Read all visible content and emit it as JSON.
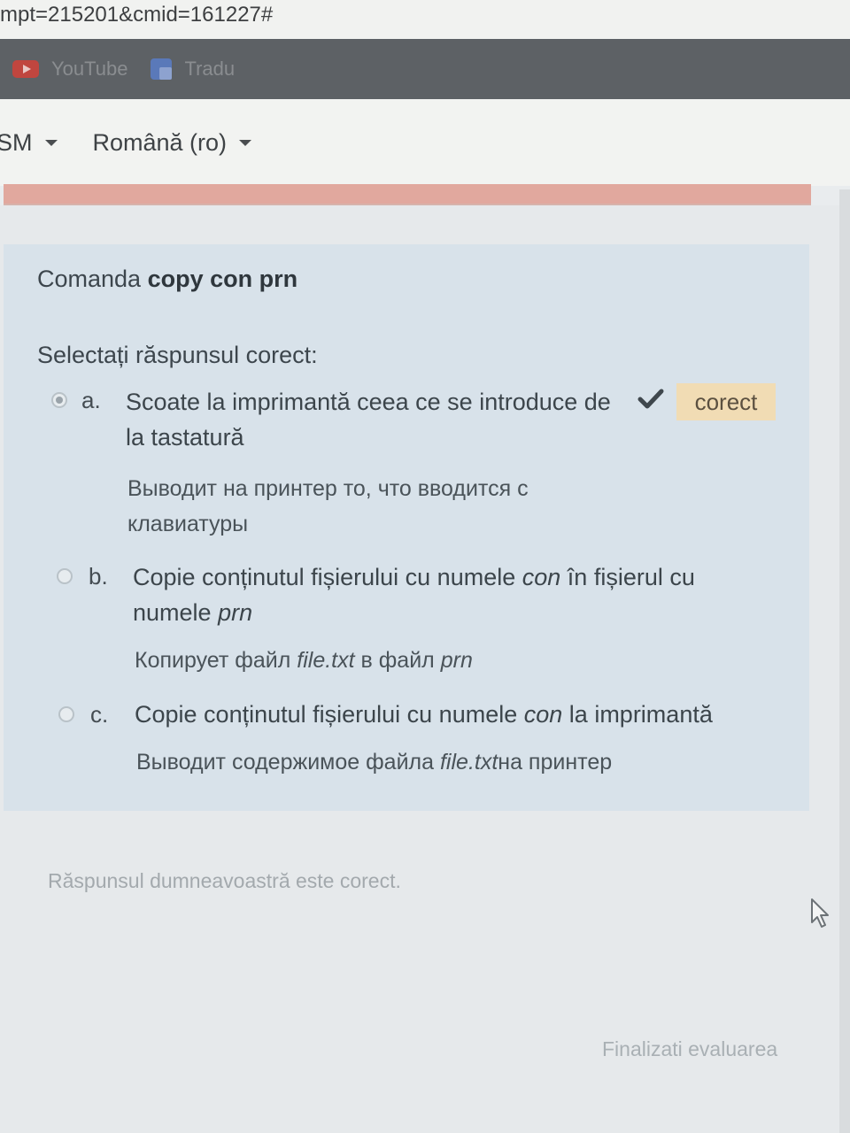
{
  "browser": {
    "url_fragment": "mpt=215201&cmid=161227#",
    "bookmarks": [
      {
        "label": "YouTube",
        "icon": "youtube-icon"
      },
      {
        "label": "Tradu",
        "icon": "translate-icon"
      }
    ]
  },
  "nav": {
    "items": [
      {
        "label": "SM"
      },
      {
        "label": "Română (ro)"
      }
    ]
  },
  "question": {
    "title_prefix": "Comanda ",
    "title_bold": "copy con prn",
    "prompt": "Selectați răspunsul corect:",
    "options": [
      {
        "letter": "a.",
        "selected": true,
        "text_line1": "Scoate la imprimantă ceea ce se introduce de",
        "text_line2": "la tastatură",
        "ru_line1": "Выводит на принтер то, что вводится с",
        "ru_line2": "клавиатуры",
        "status_badge": "corect",
        "status_icon": "checkmark-icon"
      },
      {
        "letter": "b.",
        "selected": false,
        "text_pre": "Copie conținutul fișierului cu numele ",
        "text_em1": "con",
        "text_mid": " în fișierul cu",
        "text_line2_pre": "numele ",
        "text_em2": "prn",
        "ru_pre": "Копирует файл ",
        "ru_em1": "file.txt",
        "ru_mid": " в файл ",
        "ru_em2": "prn"
      },
      {
        "letter": "c.",
        "selected": false,
        "text_pre": "Copie conținutul fișierului cu numele ",
        "text_em1": "con",
        "text_post": " la imprimantă",
        "ru_pre": "Выводит содержимое файла ",
        "ru_em1": "file.txt",
        "ru_post": "на принтер"
      }
    ],
    "colors": {
      "card_bg": "#d8e2ea",
      "badge_bg": "#f1dcb4",
      "accent_bar": "#e1a89e"
    }
  },
  "feedback": "Răspunsul dumneavoastră este corect.",
  "finish_link": "Finalizati evaluarea"
}
